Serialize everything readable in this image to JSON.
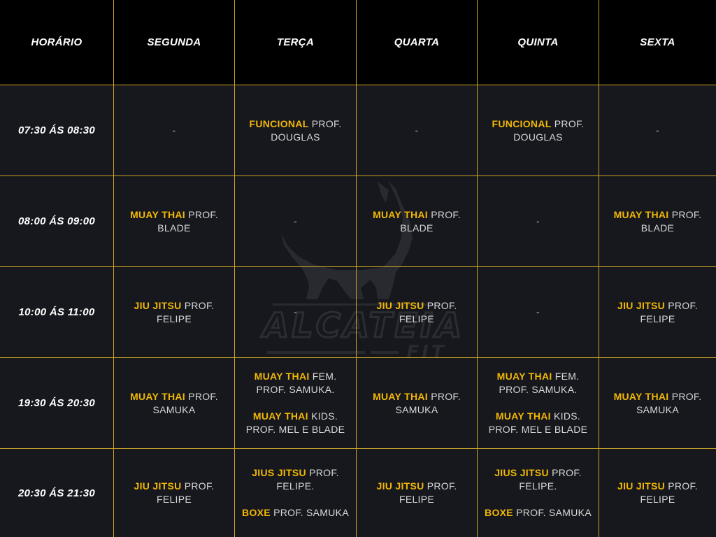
{
  "header": {
    "time": "HORÁRIO",
    "days": [
      "SEGUNDA",
      "TERÇA",
      "QUARTA",
      "QUINTA",
      "SEXTA"
    ]
  },
  "dash": "-",
  "rows": [
    {
      "time": "07:30 ÁS 08:30",
      "cells": [
        {
          "empty": true
        },
        {
          "parts": [
            {
              "cls": "FUNCIONAL",
              "text": " PROF. DOUGLAS"
            }
          ]
        },
        {
          "empty": true
        },
        {
          "parts": [
            {
              "cls": "FUNCIONAL",
              "text": " PROF. DOUGLAS"
            }
          ]
        },
        {
          "empty": true
        }
      ]
    },
    {
      "time": "08:00 ÁS 09:00",
      "cells": [
        {
          "parts": [
            {
              "cls": "MUAY THAI",
              "text": " PROF. BLADE"
            }
          ]
        },
        {
          "empty": true
        },
        {
          "parts": [
            {
              "cls": "MUAY THAI",
              "text": " PROF. BLADE"
            }
          ]
        },
        {
          "empty": true
        },
        {
          "parts": [
            {
              "cls": "MUAY THAI",
              "text": " PROF. BLADE"
            }
          ]
        }
      ]
    },
    {
      "time": "10:00 ÁS 11:00",
      "cells": [
        {
          "parts": [
            {
              "cls": "JIU JITSU",
              "text": " PROF. FELIPE"
            }
          ]
        },
        {
          "empty": true
        },
        {
          "parts": [
            {
              "cls": "JIU JITSU",
              "text": " PROF. FELIPE"
            }
          ]
        },
        {
          "empty": true
        },
        {
          "parts": [
            {
              "cls": "JIU JITSU",
              "text": " PROF. FELIPE"
            }
          ]
        }
      ]
    },
    {
      "time": "19:30 ÁS 20:30",
      "cells": [
        {
          "parts": [
            {
              "cls": "MUAY THAI",
              "text": " PROF. SAMUKA"
            }
          ]
        },
        {
          "parts": [
            {
              "cls": "MUAY THAI",
              "text": " FEM. PROF. SAMUKA."
            },
            {
              "cls": "MUAY THAI",
              "text": " KIDS. PROF. MEL E BLADE"
            }
          ]
        },
        {
          "parts": [
            {
              "cls": "MUAY THAI",
              "text": " PROF. SAMUKA"
            }
          ]
        },
        {
          "parts": [
            {
              "cls": "MUAY THAI",
              "text": " FEM. PROF. SAMUKA."
            },
            {
              "cls": "MUAY THAI",
              "text": " KIDS. PROF. MEL E BLADE"
            }
          ]
        },
        {
          "parts": [
            {
              "cls": "MUAY THAI",
              "text": " PROF. SAMUKA"
            }
          ]
        }
      ]
    },
    {
      "time": "20:30 ÁS 21:30",
      "cells": [
        {
          "parts": [
            {
              "cls": "JIU JITSU",
              "text": " PROF. FELIPE"
            }
          ]
        },
        {
          "parts": [
            {
              "cls": "JIUS JITSU",
              "text": " PROF. FELIPE."
            },
            {
              "cls": "BOXE",
              "text": " PROF. SAMUKA"
            }
          ]
        },
        {
          "parts": [
            {
              "cls": "JIU JITSU",
              "text": " PROF. FELIPE"
            }
          ]
        },
        {
          "parts": [
            {
              "cls": "JIUS JITSU",
              "text": " PROF. FELIPE."
            },
            {
              "cls": "BOXE",
              "text": " PROF. SAMUKA"
            }
          ]
        },
        {
          "parts": [
            {
              "cls": "JIU JITSU",
              "text": " PROF. FELIPE"
            }
          ]
        }
      ]
    }
  ],
  "watermark": {
    "icon": "wolf-icon",
    "brand": "ALCATEIA",
    "sub": "FIT"
  }
}
